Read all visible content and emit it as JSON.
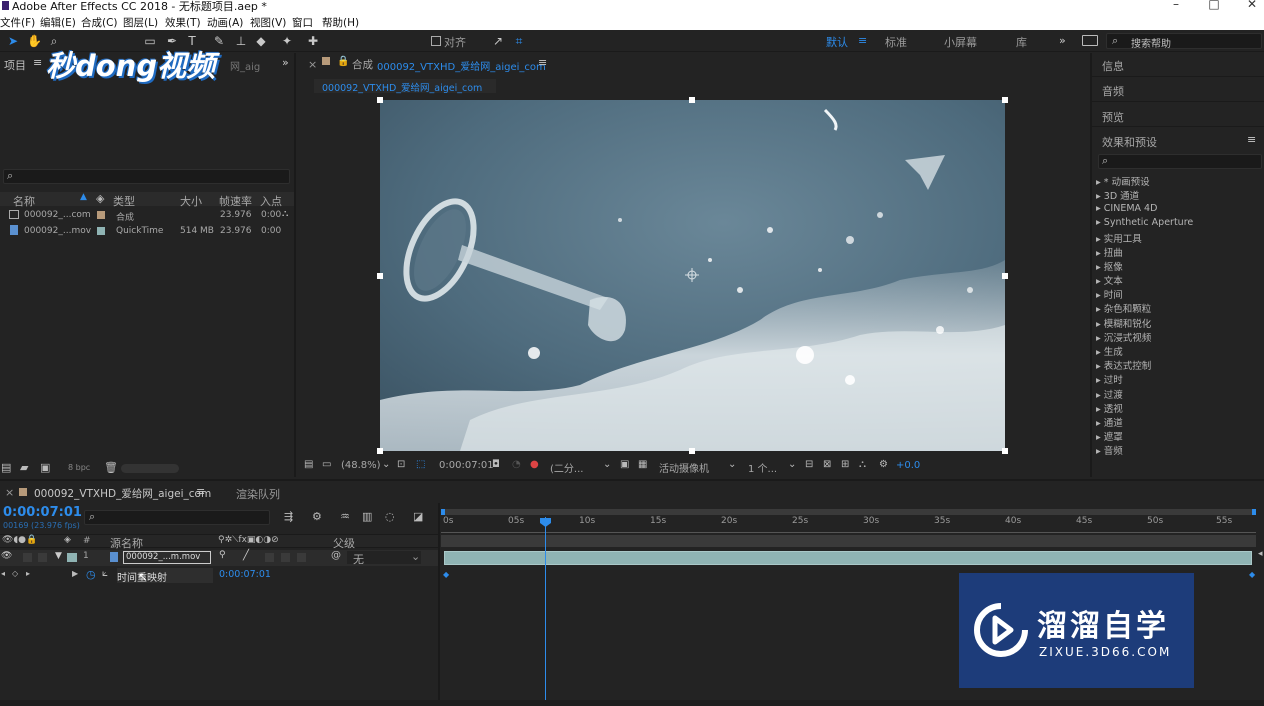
{
  "title": "Adobe After Effects CC 2018 - 无标题项目.aep *",
  "menus": [
    "文件(F)",
    "编辑(E)",
    "合成(C)",
    "图层(L)",
    "效果(T)",
    "动画(A)",
    "视图(V)",
    "窗口",
    "帮助(H)"
  ],
  "toolbar": {
    "align_label": "对齐",
    "workspaces": [
      "默认",
      "标准",
      "小屏幕",
      "库"
    ],
    "search_placeholder": "搜索帮助"
  },
  "watermark_top": "秒dong视频",
  "project": {
    "tab": "项目",
    "tab_extra": "网_aig",
    "columns": [
      "名称",
      "类型",
      "大小",
      "帧速率",
      "入点"
    ],
    "items": [
      {
        "name": "000092_...com",
        "type": "合成",
        "size": "",
        "fps": "23.976",
        "in": "0:00"
      },
      {
        "name": "000092_...mov",
        "type": "QuickTime",
        "size": "514 MB",
        "fps": "23.976",
        "in": "0:00"
      }
    ],
    "bpc": "8 bpc"
  },
  "comp": {
    "tab_prefix": "合成",
    "tab_name": "000092_VTXHD_爱给网_aigei_com",
    "sub_tab": "000092_VTXHD_爱给网_aigei_com",
    "zoom": "(48.8%)",
    "time": "0:00:07:01",
    "resolution": "(二分...",
    "camera": "活动摄像机",
    "views": "1 个...",
    "exposure": "+0.0"
  },
  "right_panels": {
    "info": "信息",
    "audio": "音频",
    "preview": "预览",
    "effects": "效果和预设",
    "effects_list": [
      "* 动画预设",
      "3D 通道",
      "CINEMA 4D",
      "Synthetic Aperture",
      "实用工具",
      "扭曲",
      "抠像",
      "文本",
      "时间",
      "杂色和颗粒",
      "模糊和锐化",
      "沉浸式视频",
      "生成",
      "表达式控制",
      "过时",
      "过渡",
      "透视",
      "通道",
      "遮罩",
      "音频"
    ]
  },
  "timeline": {
    "tab": "000092_VTXHD_爱给网_aigei_com",
    "render_queue": "渲染队列",
    "timecode": "0:00:07:01",
    "frames": "00169 (23.976 fps)",
    "col_source": "源名称",
    "col_parent": "父级",
    "col_num": "#",
    "layer": {
      "num": "1",
      "name": "000092_...m.mov",
      "parent": "无"
    },
    "prop": {
      "name": "时间重映射",
      "value": "0:00:07:01"
    },
    "ruler": [
      "0s",
      "05s",
      "10s",
      "15s",
      "20s",
      "25s",
      "30s",
      "35s",
      "40s",
      "45s",
      "50s",
      "55s"
    ]
  },
  "watermark": {
    "title": "溜溜自学",
    "url": "ZIXUE.3D66.COM"
  },
  "colors": {
    "accent": "#2d8ceb",
    "water": "#4e6b7d",
    "layer_bar": "#8fb3b3"
  }
}
